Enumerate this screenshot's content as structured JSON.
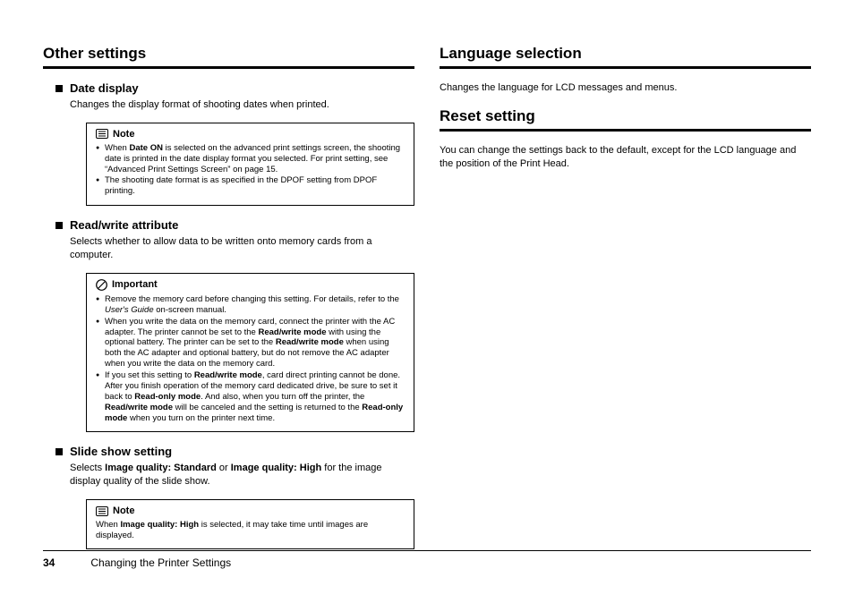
{
  "left": {
    "title": "Other settings",
    "date": {
      "heading": "Date display",
      "desc": "Changes the display format of shooting dates when printed.",
      "note_label": "Note",
      "note1_a": "When ",
      "note1_b": "Date ON",
      "note1_c": " is selected on the advanced print settings screen, the shooting date is printed in the date display format you selected. For print setting, see “Advanced Print Settings Screen” on page 15.",
      "note2": "The shooting date format is as specified in the DPOF setting from DPOF printing."
    },
    "rw": {
      "heading": "Read/write attribute",
      "desc": "Selects whether to allow data to be written onto memory cards from a computer.",
      "imp_label": "Important",
      "b1_a": "Remove the memory card before changing this setting. For details, refer to the ",
      "b1_b": "User's Guide",
      "b1_c": " on-screen manual.",
      "b2_a": "When you write the data on the memory card, connect the printer with the AC adapter. The printer cannot be set to the ",
      "b2_b": "Read/write mode",
      "b2_c": " with using the optional battery. The printer can be set to the ",
      "b2_d": "Read/write mode",
      "b2_e": " when using both the AC adapter and optional battery, but do not remove the AC adapter when you write the data on the memory card.",
      "b3_a": "If you set this setting to ",
      "b3_b": "Read/write mode",
      "b3_c": ", card direct printing cannot be done. After you finish operation of the memory card dedicated drive, be sure to set it back to ",
      "b3_d": "Read-only mode",
      "b3_e": ". And also, when you turn off the printer, the ",
      "b3_f": "Read/write mode",
      "b3_g": " will be canceled and the setting is returned to the ",
      "b3_h": "Read-only mode",
      "b3_i": " when you turn on the printer next time."
    },
    "slide": {
      "heading": "Slide show setting",
      "desc_a": "Selects ",
      "desc_b": "Image quality: Standard",
      "desc_c": " or ",
      "desc_d": "Image quality: High",
      "desc_e": " for the image display quality of the slide show.",
      "note_label": "Note",
      "note_a": "When ",
      "note_b": "Image quality: High",
      "note_c": " is selected, it may take time until images are displayed."
    }
  },
  "right": {
    "lang_title": "Language selection",
    "lang_desc": "Changes the language for LCD messages and menus.",
    "reset_title": "Reset setting",
    "reset_desc": "You can change the settings back to the default, except for the LCD language and the position of the Print Head."
  },
  "footer": {
    "page": "34",
    "chapter": "Changing the Printer Settings"
  }
}
